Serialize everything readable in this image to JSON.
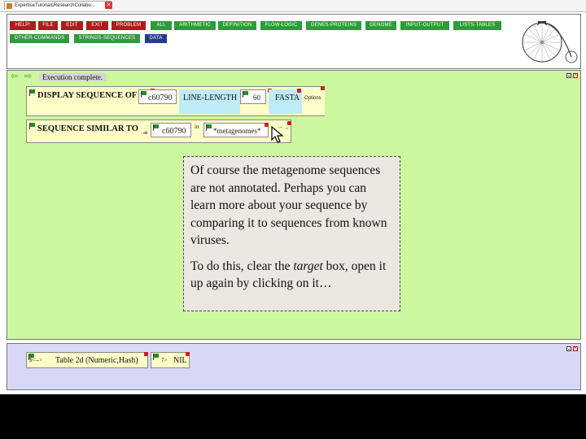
{
  "browser": {
    "tab_title": "ExpertiseTutorialsResearchCollabo..."
  },
  "commands": {
    "help": "HELP!",
    "file": "FILE",
    "edit": "EDIT",
    "exit": "EXIT",
    "problem": "PROBLEM",
    "all": "ALL",
    "arithmetic": "ARITHMETIC",
    "definition": "DEFINITION",
    "flow_logic": "FLOW-LOGIC",
    "genes_proteins": "GENES-PROTEINS",
    "genome": "GENOME",
    "input_output": "INPUT-OUTPUT",
    "lists_tables": "LISTS-TABLES",
    "other_commands": "OTHER-COMMANDS",
    "strings_sequences": "STRINGS-SEQUENCES",
    "data": "DATA"
  },
  "workspace": {
    "status": "Execution complete.",
    "display_sequence": {
      "label": "DISPLAY SEQUENCE OF",
      "arg": "c60790",
      "option": "LINE-LENGTH",
      "option_value": "60",
      "format": "FASTA",
      "options_link": "Options"
    },
    "sequence_similar": {
      "label": "SEQUENCE SIMILAR TO",
      "arg_prefix": "→ab",
      "arg": "c60790",
      "in_label": "in",
      "target": "*metagenomes*",
      "more": "→ ,,"
    }
  },
  "callout": {
    "para1": "Of course the metagenome sequences are not annotated. Perhaps you can learn more about your sequence by comparing it to sequences from known viruses.",
    "para2_before": "To do this, clear the ",
    "para2_em": "target",
    "para2_after": " box, open it up again by clicking on it…"
  },
  "results": {
    "item1_prefix": "$<-->",
    "item1_text": "Table 2d (Numeric,Hash)",
    "item2_prefix": "7>",
    "item2_text": "NIL"
  },
  "colors": {
    "workspace_bg": "#ccf79f",
    "results_bg": "#d8d8f6",
    "command_red": "#b11b1b",
    "command_green": "#2f9a3a",
    "command_blue": "#243c8e"
  }
}
